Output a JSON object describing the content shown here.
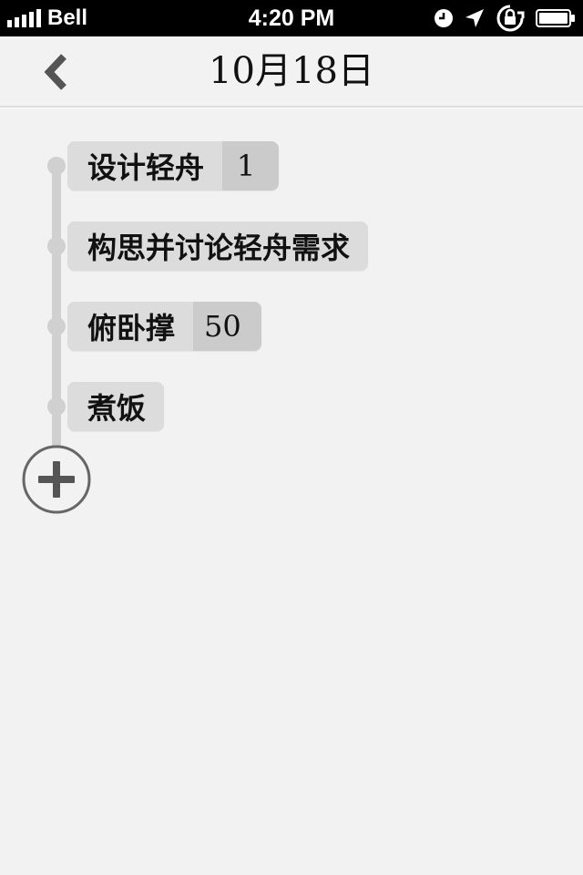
{
  "status_bar": {
    "carrier": "Bell",
    "time": "4:20 PM",
    "icons": [
      "signal-icon",
      "alarm-icon",
      "location-icon",
      "rotation-lock-icon",
      "battery-icon"
    ]
  },
  "nav": {
    "title": "10月18日",
    "back_icon": "chevron-left-icon"
  },
  "tasks": [
    {
      "name": "设计轻舟",
      "count": "1"
    },
    {
      "name": "构思并讨论轻舟需求",
      "count": null
    },
    {
      "name": "俯卧撑",
      "count": "50"
    },
    {
      "name": "煮饭",
      "count": null
    }
  ],
  "add_icon": "plus-circle-icon",
  "colors": {
    "background": "#f2f2f2",
    "status_bar": "#000000",
    "timeline": "#d0d0d0",
    "pill": "#dcdcdc",
    "pill_count": "#cbcbcb",
    "icon_gray": "#555555"
  }
}
